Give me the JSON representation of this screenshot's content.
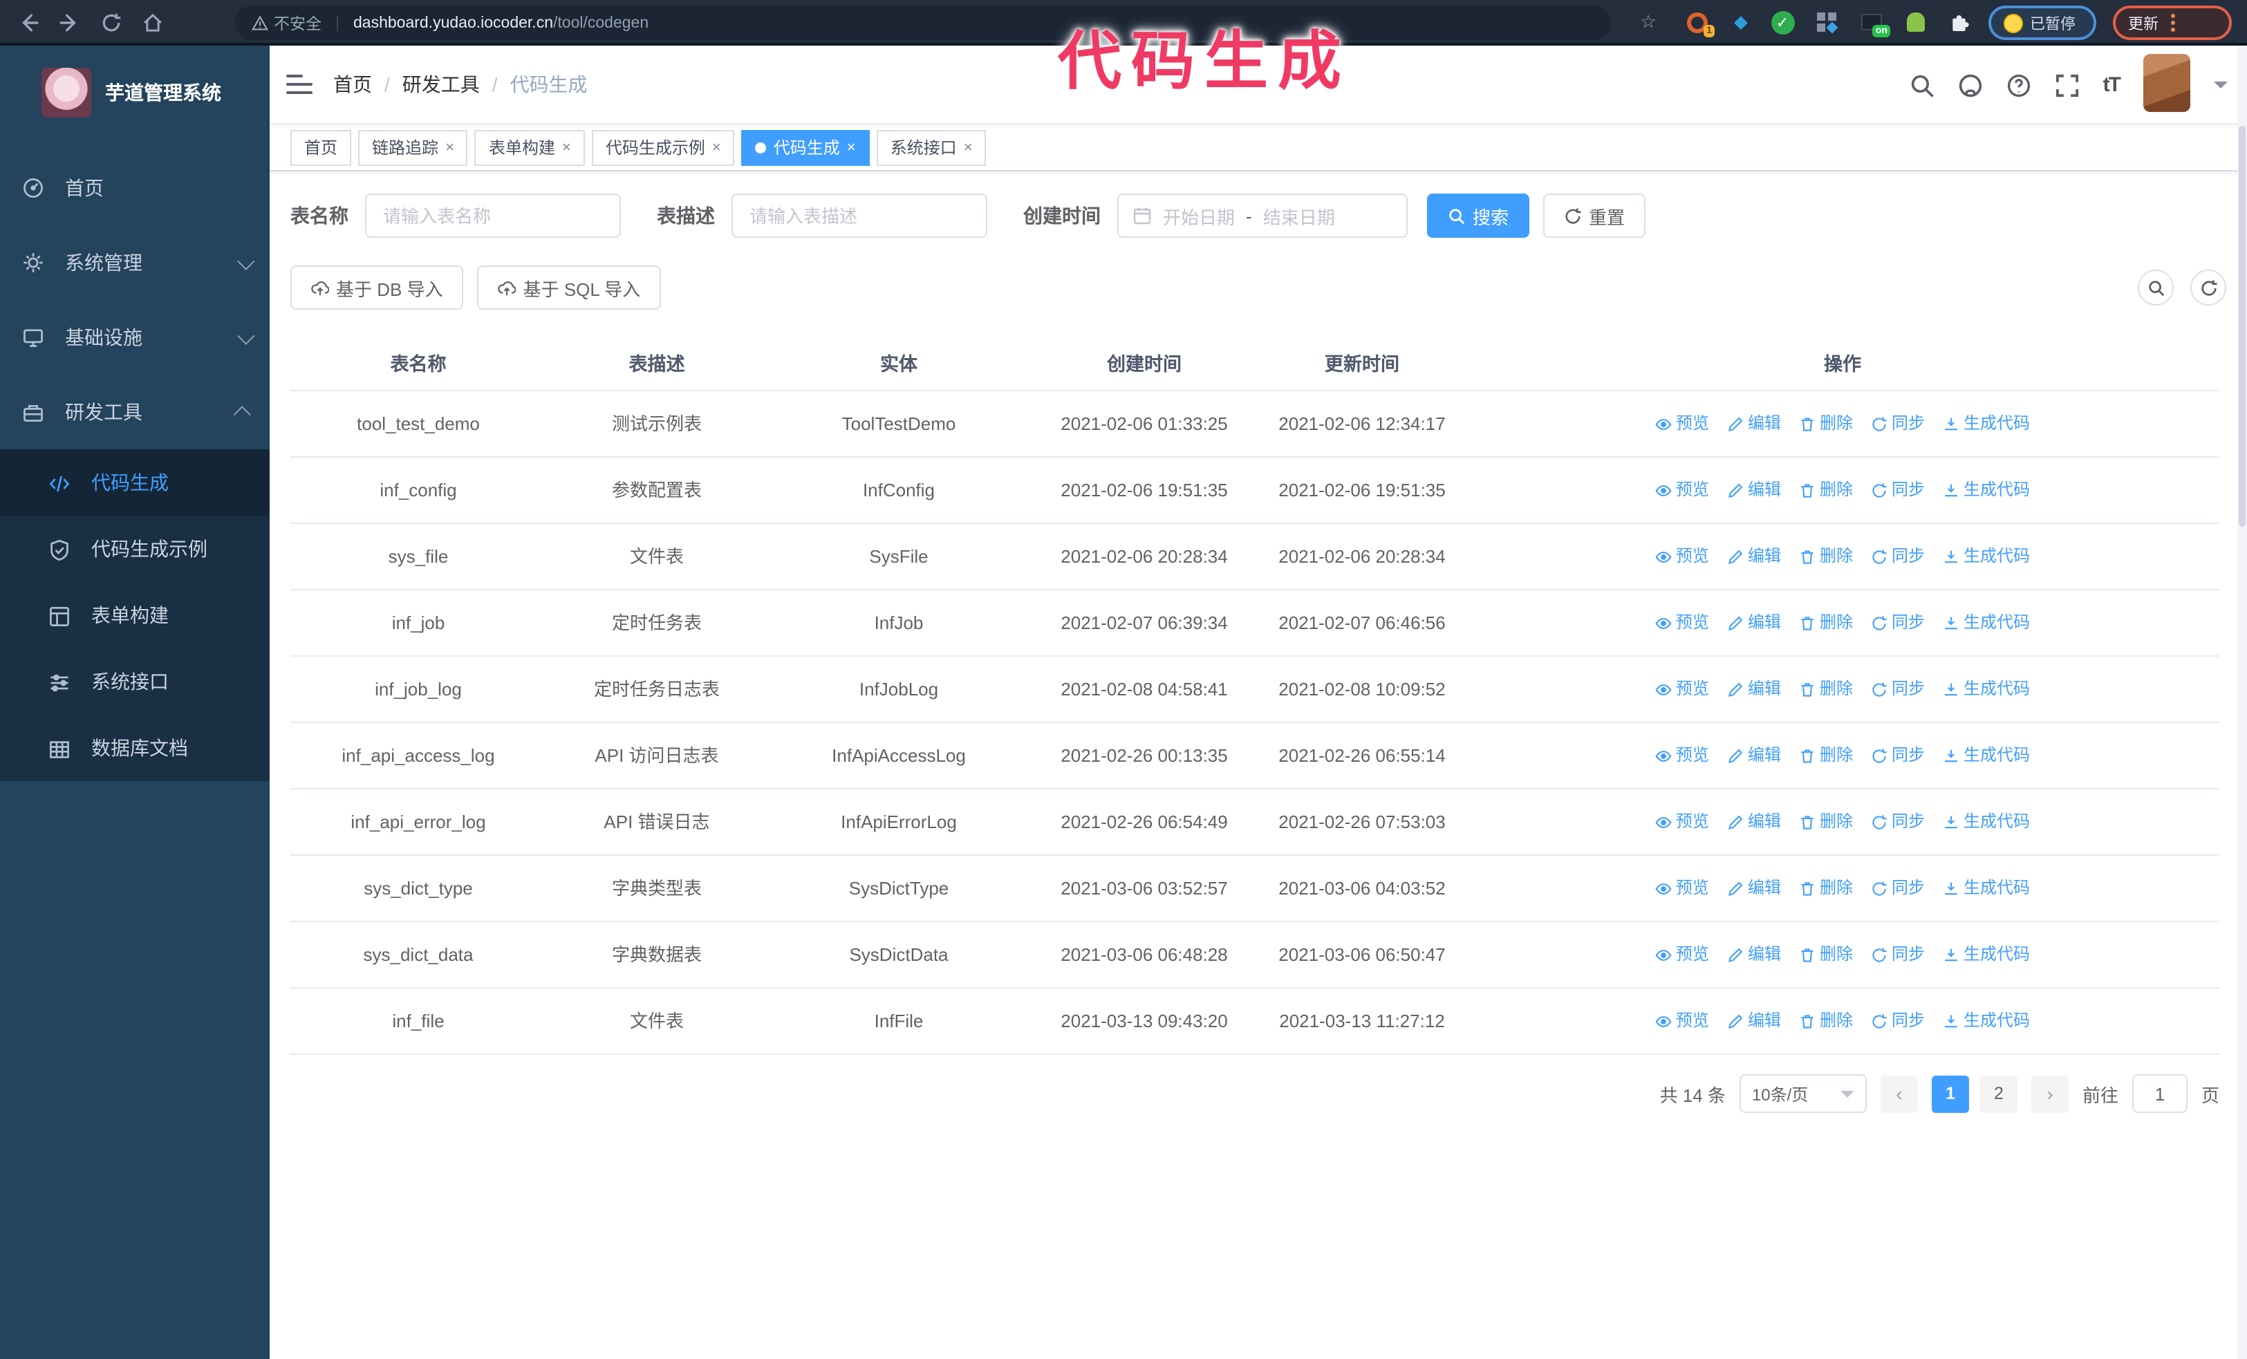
{
  "colors": {
    "primary": "#409eff",
    "annotation": "#ef3a63",
    "sidebar_bg": "#24435c",
    "submenu_bg": "#192f43"
  },
  "annotation": {
    "text": "代码生成"
  },
  "browser": {
    "security_label": "不安全",
    "url_domain": "dashboard.yudao.iocoder.cn",
    "url_path": "/tool/codegen",
    "ext_badge_count": "1",
    "ext_badge_on": "on",
    "paused_badge": "已暂停",
    "update_badge": "更新"
  },
  "sidebar": {
    "title": "芋道管理系统",
    "items": [
      {
        "label": "首页",
        "icon": "dashboard-icon"
      },
      {
        "label": "系统管理",
        "icon": "gear-icon",
        "chevron": "down"
      },
      {
        "label": "基础设施",
        "icon": "monitor-icon",
        "chevron": "down"
      },
      {
        "label": "研发工具",
        "icon": "toolbox-icon",
        "chevron": "up",
        "children": [
          {
            "label": "代码生成",
            "icon": "code-icon",
            "active": true
          },
          {
            "label": "代码生成示例",
            "icon": "shield-check-icon"
          },
          {
            "label": "表单构建",
            "icon": "form-icon"
          },
          {
            "label": "系统接口",
            "icon": "sliders-icon"
          },
          {
            "label": "数据库文档",
            "icon": "database-icon"
          }
        ]
      }
    ]
  },
  "navbar": {
    "breadcrumb": {
      "items": [
        "首页",
        "研发工具",
        "代码生成"
      ],
      "separator": "/"
    }
  },
  "tabs": [
    {
      "label": "首页",
      "closable": false,
      "active": false
    },
    {
      "label": "链路追踪",
      "closable": true,
      "active": false
    },
    {
      "label": "表单构建",
      "closable": true,
      "active": false
    },
    {
      "label": "代码生成示例",
      "closable": true,
      "active": false
    },
    {
      "label": "代码生成",
      "closable": true,
      "active": true
    },
    {
      "label": "系统接口",
      "closable": true,
      "active": false
    }
  ],
  "filters": {
    "table_name": {
      "label": "表名称",
      "placeholder": "请输入表名称"
    },
    "table_desc": {
      "label": "表描述",
      "placeholder": "请输入表描述"
    },
    "create_time": {
      "label": "创建时间",
      "start_placeholder": "开始日期",
      "range_separator": "-",
      "end_placeholder": "结束日期"
    },
    "search_label": "搜索",
    "reset_label": "重置"
  },
  "toolbar": {
    "import_db_label": "基于 DB 导入",
    "import_sql_label": "基于 SQL 导入"
  },
  "table": {
    "columns": [
      "表名称",
      "表描述",
      "实体",
      "创建时间",
      "更新时间",
      "操作"
    ],
    "rows": [
      {
        "name": "tool_test_demo",
        "description": "测试示例表",
        "entity": "ToolTestDemo",
        "created": "2021-02-06 01:33:25",
        "updated": "2021-02-06 12:34:17"
      },
      {
        "name": "inf_config",
        "description": "参数配置表",
        "entity": "InfConfig",
        "created": "2021-02-06 19:51:35",
        "updated": "2021-02-06 19:51:35"
      },
      {
        "name": "sys_file",
        "description": "文件表",
        "entity": "SysFile",
        "created": "2021-02-06 20:28:34",
        "updated": "2021-02-06 20:28:34"
      },
      {
        "name": "inf_job",
        "description": "定时任务表",
        "entity": "InfJob",
        "created": "2021-02-07 06:39:34",
        "updated": "2021-02-07 06:46:56"
      },
      {
        "name": "inf_job_log",
        "description": "定时任务日志表",
        "entity": "InfJobLog",
        "created": "2021-02-08 04:58:41",
        "updated": "2021-02-08 10:09:52"
      },
      {
        "name": "inf_api_access_log",
        "description": "API 访问日志表",
        "entity": "InfApiAccessLog",
        "created": "2021-02-26 00:13:35",
        "updated": "2021-02-26 06:55:14"
      },
      {
        "name": "inf_api_error_log",
        "description": "API 错误日志",
        "entity": "InfApiErrorLog",
        "created": "2021-02-26 06:54:49",
        "updated": "2021-02-26 07:53:03"
      },
      {
        "name": "sys_dict_type",
        "description": "字典类型表",
        "entity": "SysDictType",
        "created": "2021-03-06 03:52:57",
        "updated": "2021-03-06 04:03:52"
      },
      {
        "name": "sys_dict_data",
        "description": "字典数据表",
        "entity": "SysDictData",
        "created": "2021-03-06 06:48:28",
        "updated": "2021-03-06 06:50:47"
      },
      {
        "name": "inf_file",
        "description": "文件表",
        "entity": "InfFile",
        "created": "2021-03-13 09:43:20",
        "updated": "2021-03-13 11:27:12"
      }
    ],
    "row_actions": [
      {
        "label": "预览",
        "icon": "eye-icon"
      },
      {
        "label": "编辑",
        "icon": "edit-icon"
      },
      {
        "label": "删除",
        "icon": "delete-icon"
      },
      {
        "label": "同步",
        "icon": "sync-icon"
      },
      {
        "label": "生成代码",
        "icon": "download-icon"
      }
    ]
  },
  "pagination": {
    "total": "共 14 条",
    "page_size": "10条/页",
    "pages": [
      "1",
      "2"
    ],
    "active_page": "1",
    "goto_label": "前往",
    "goto_value": "1",
    "goto_suffix": "页"
  }
}
